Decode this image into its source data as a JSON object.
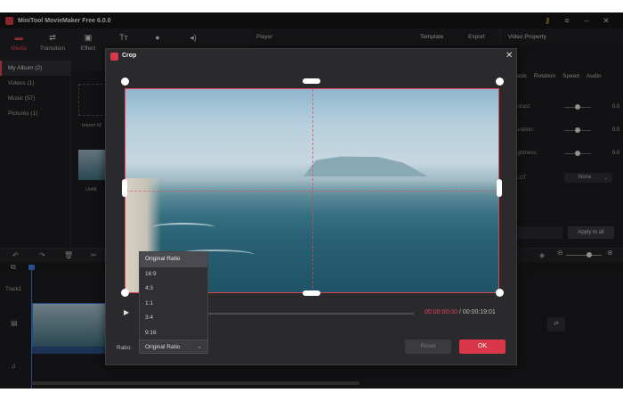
{
  "app": {
    "title": "MiniTool MovieMaker Free 6.0.0"
  },
  "toolbar": {
    "items": [
      {
        "label": "Media",
        "icon": "folder-icon"
      },
      {
        "label": "Transition",
        "icon": "transition-icon"
      },
      {
        "label": "Effect",
        "icon": "effect-icon"
      },
      {
        "label": "",
        "icon": "text-icon"
      },
      {
        "label": "",
        "icon": "elements-icon"
      },
      {
        "label": "",
        "icon": "audio-icon"
      }
    ]
  },
  "player": {
    "label": "Player",
    "template_label": "Template",
    "export_label": "Export"
  },
  "properties": {
    "title": "Video Property",
    "tabs": [
      "Basic",
      "Rotation",
      "Speed",
      "Audio"
    ],
    "rows": [
      {
        "label": "ntrast:",
        "value": "0.0"
      },
      {
        "label": "uration:",
        "value": "0.0"
      },
      {
        "label": "ightness:",
        "value": "0.0"
      }
    ],
    "lut_label": "LUT",
    "lut_value": "None",
    "apply_all": "Apply to all"
  },
  "sidebar": {
    "items": [
      {
        "label": "My Album (2)",
        "active": true
      },
      {
        "label": "Videos (1)"
      },
      {
        "label": "Music (57)"
      },
      {
        "label": "Pictures (1)"
      }
    ]
  },
  "media": {
    "import_label": "Import M",
    "untitled": "Untitl"
  },
  "timeline": {
    "track_label": "Track1"
  },
  "crop": {
    "title": "Crop",
    "current_time": "00:00:00:00",
    "separator": " / ",
    "total_time": "00:00:19:01",
    "ratio_label": "Ratio:",
    "ratio_value": "Original Ratio",
    "ratio_options": [
      "Original Ratio",
      "16:9",
      "4:3",
      "1:1",
      "3:4",
      "9:16"
    ],
    "reset_label": "Reset",
    "ok_label": "OK"
  },
  "colors": {
    "accent": "#e04454",
    "playhead": "#3a78d8",
    "background": "#1d1d1f"
  }
}
